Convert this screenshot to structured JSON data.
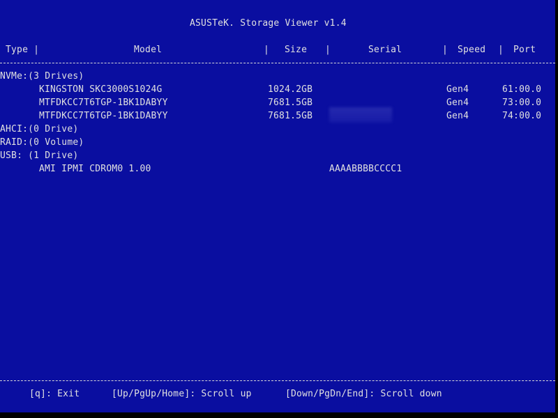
{
  "app": {
    "title": "ASUSTeK. Storage Viewer v1.4"
  },
  "header": {
    "type": "Type |",
    "model": "Model",
    "sep1": "|",
    "size": "Size",
    "sep2": "|",
    "serial": "Serial",
    "sep3": "|",
    "speed": "Speed",
    "sep4": "|",
    "port": "Port"
  },
  "groups": {
    "nvme": {
      "label": "NVMe:(3 Drives)",
      "drives": [
        {
          "model": "KINGSTON SKC3000S1024G",
          "size": "1024.2GB",
          "serial": "",
          "speed": "Gen4",
          "port": "61:00.0"
        },
        {
          "model": "MTFDKCC7T6TGP-1BK1DABYY",
          "size": "7681.5GB",
          "serial": "",
          "speed": "Gen4",
          "port": "73:00.0"
        },
        {
          "model": "MTFDKCC7T6TGP-1BK1DABYY",
          "size": "7681.5GB",
          "serial": "",
          "speed": "Gen4",
          "port": "74:00.0"
        }
      ]
    },
    "ahci": {
      "label": "AHCI:(0 Drive)"
    },
    "raid": {
      "label": "RAID:(0 Volume)"
    },
    "usb": {
      "label": "USB: (1 Drive)",
      "drives": [
        {
          "model": "AMI IPMI CDROM0 1.00",
          "serial": "AAAABBBBCCCC1"
        }
      ]
    }
  },
  "footer": {
    "exit": "[q]: Exit",
    "scroll_up": "[Up/PgUp/Home]: Scroll up",
    "scroll_down": "[Down/PgDn/End]: Scroll down"
  },
  "colors": {
    "background": "#0a0ea0",
    "text": "#e0e0e0"
  }
}
